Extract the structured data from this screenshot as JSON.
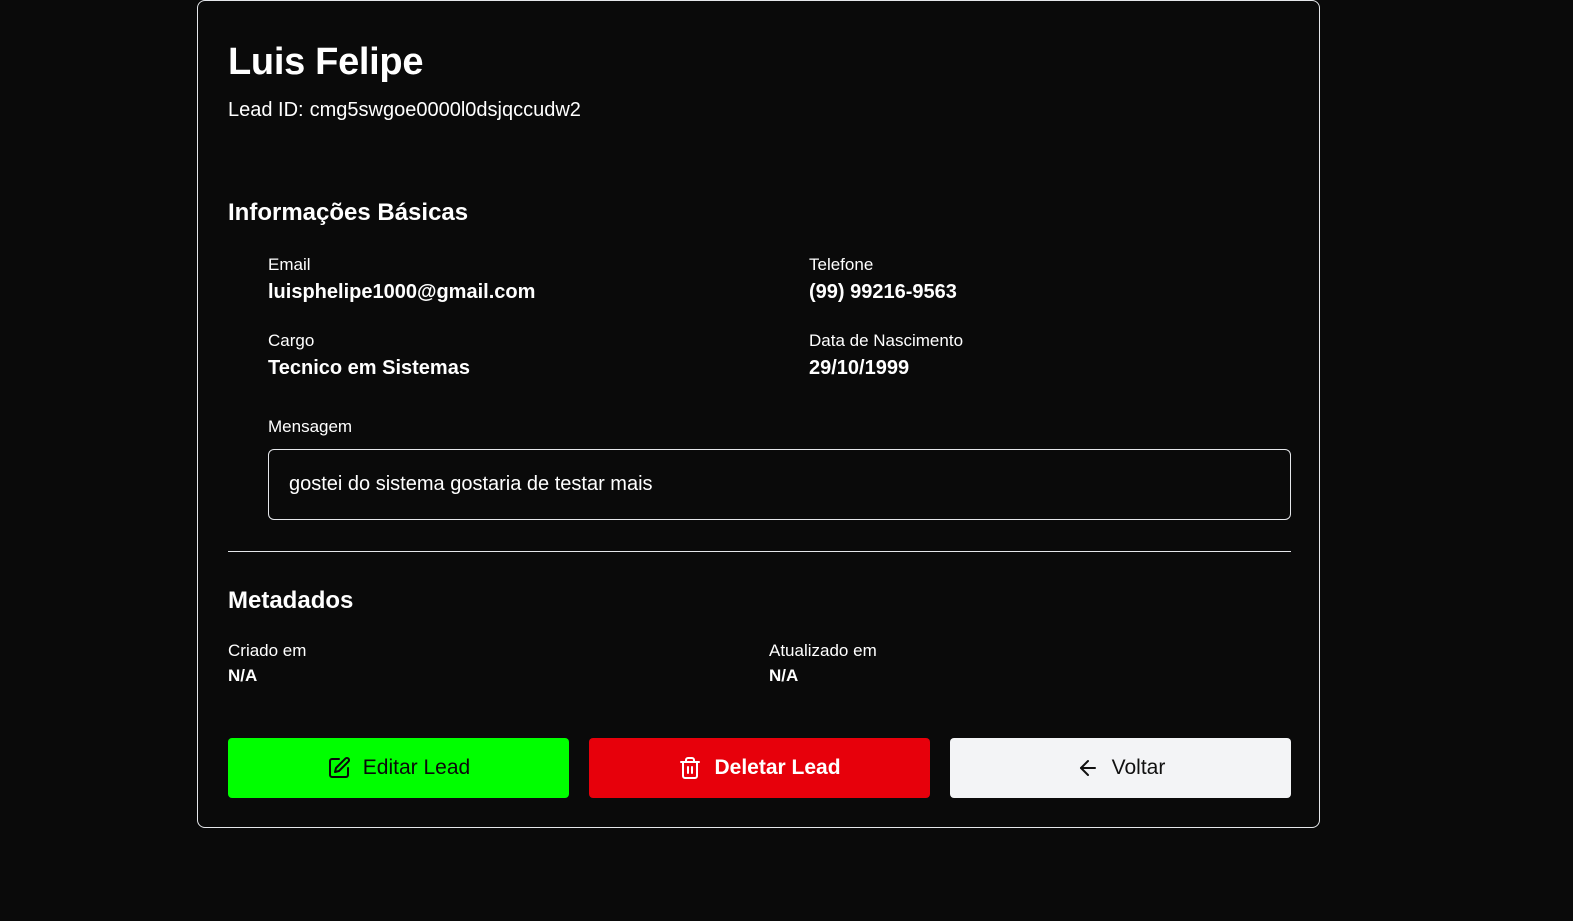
{
  "lead": {
    "name": "Luis Felipe",
    "id_label": "Lead ID:",
    "id_value": "cmg5swgoe0000l0dsjqccudw2"
  },
  "basic_info": {
    "title": "Informações Básicas",
    "email_label": "Email",
    "email_value": "luisphelipe1000@gmail.com",
    "phone_label": "Telefone",
    "phone_value": "(99) 99216-9563",
    "role_label": "Cargo",
    "role_value": "Tecnico em Sistemas",
    "birth_label": "Data de Nascimento",
    "birth_value": "29/10/1999",
    "message_label": "Mensagem",
    "message_value": "gostei do sistema gostaria de testar mais"
  },
  "metadata": {
    "title": "Metadados",
    "created_label": "Criado em",
    "created_value": "N/A",
    "updated_label": "Atualizado em",
    "updated_value": "N/A"
  },
  "actions": {
    "edit_label": "Editar Lead",
    "delete_label": "Deletar Lead",
    "back_label": "Voltar",
    "edit_icon": "edit-icon",
    "delete_icon": "trash-icon",
    "back_icon": "arrow-left-icon"
  },
  "colors": {
    "background": "#0a0a0a",
    "edit_button": "#00ff00",
    "delete_button": "#e7000b",
    "back_button": "#f3f4f6",
    "border": "#e5e7eb"
  }
}
